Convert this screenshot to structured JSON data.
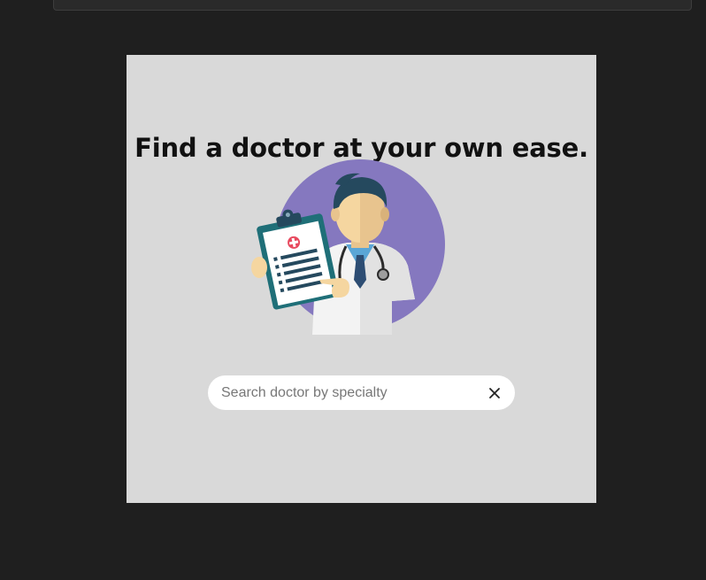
{
  "hero": {
    "headline": "Find a doctor at your own ease."
  },
  "search": {
    "placeholder": "Search doctor by specialty",
    "value": ""
  },
  "icons": {
    "illustration": "doctor-with-clipboard-illustration",
    "clear": "close-icon"
  },
  "colors": {
    "background": "#1f1f1f",
    "card": "#d9d9d9",
    "illustration_circle": "#8578bf",
    "clipboard": "#1f6f78"
  }
}
